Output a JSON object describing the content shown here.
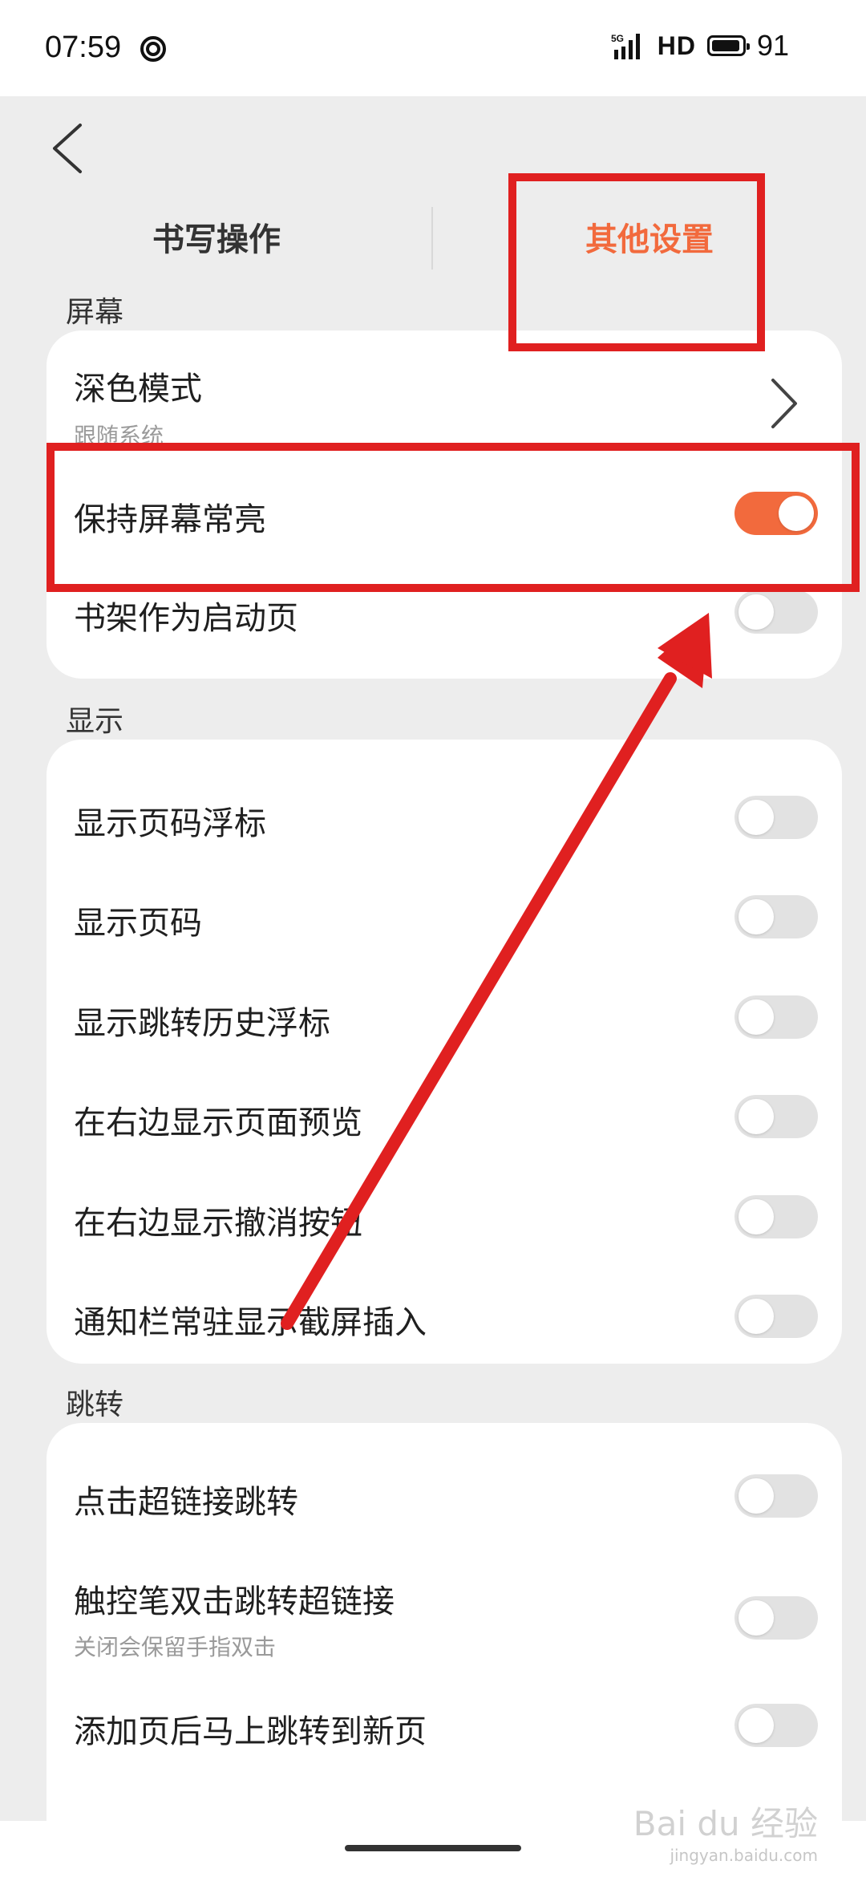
{
  "status_bar": {
    "time": "07:59",
    "network": "5G",
    "hd": "HD",
    "battery": "91"
  },
  "tabs": [
    {
      "label": "书写操作",
      "active": false
    },
    {
      "label": "其他设置",
      "active": true
    }
  ],
  "accent_color": "#f26a3d",
  "annotation_color": "#e02020",
  "sections": {
    "screen": {
      "label": "屏幕",
      "items": [
        {
          "title": "深色模式",
          "subtitle": "跟随系统",
          "control": "chevron-right-icon"
        },
        {
          "title": "保持屏幕常亮",
          "toggle": true
        },
        {
          "title": "书架作为启动页",
          "toggle": false
        }
      ]
    },
    "display": {
      "label": "显示",
      "items": [
        {
          "title": "显示页码浮标",
          "toggle": false
        },
        {
          "title": "显示页码",
          "toggle": false
        },
        {
          "title": "显示跳转历史浮标",
          "toggle": false
        },
        {
          "title": "在右边显示页面预览",
          "toggle": false
        },
        {
          "title": "在右边显示撤消按钮",
          "toggle": false
        },
        {
          "title": "通知栏常驻显示截屏插入",
          "toggle": false
        }
      ]
    },
    "jump": {
      "label": "跳转",
      "items": [
        {
          "title": "点击超链接跳转",
          "toggle": false
        },
        {
          "title": "触控笔双击跳转超链接",
          "subtitle": "关闭会保留手指双击",
          "toggle": false
        },
        {
          "title": "添加页后马上跳转到新页",
          "toggle": false
        }
      ]
    }
  },
  "watermark": {
    "brand": "Bai du 经验",
    "site": "jingyan.baidu.com"
  }
}
